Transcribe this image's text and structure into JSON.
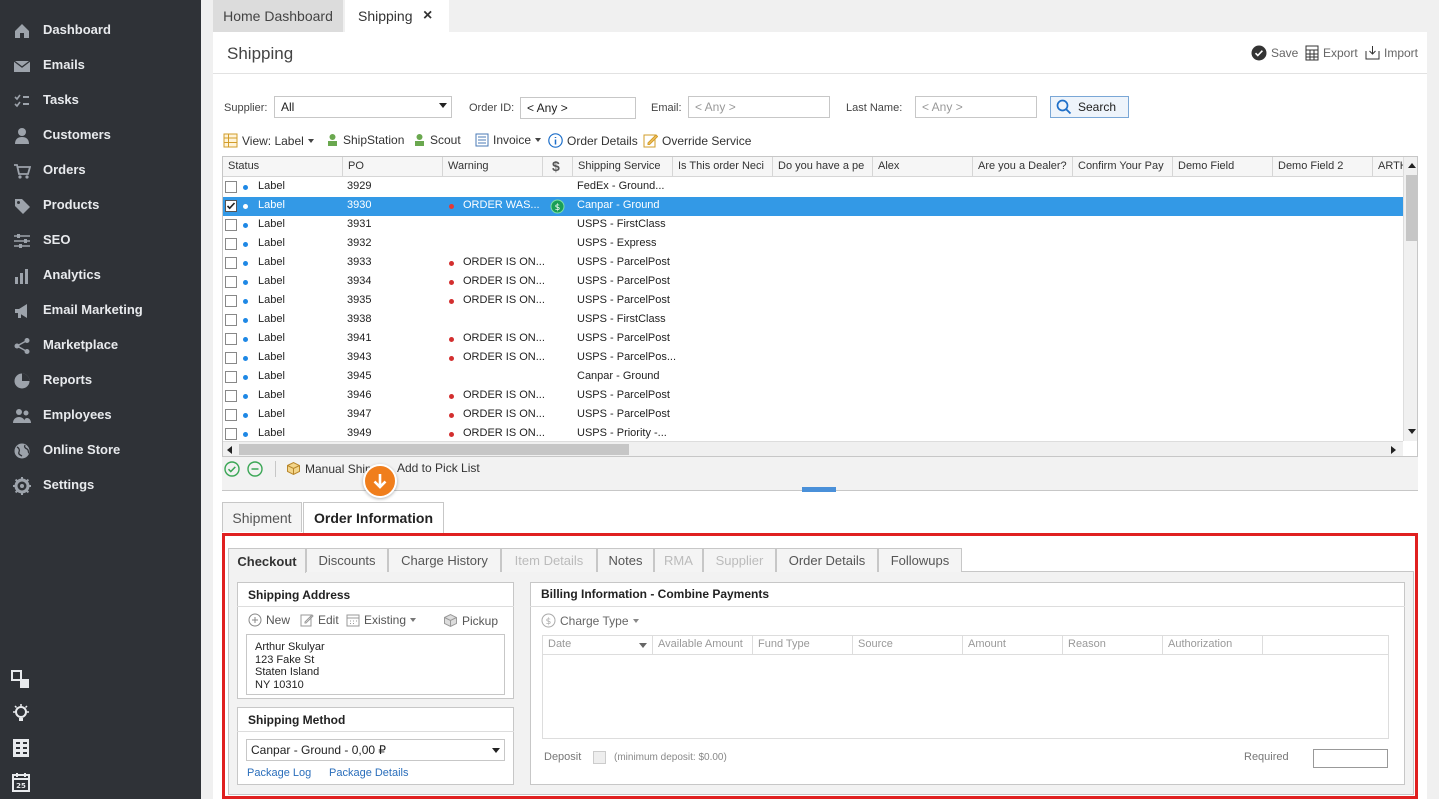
{
  "sidebar": {
    "items": [
      {
        "label": "Dashboard",
        "icon": "home-icon"
      },
      {
        "label": "Emails",
        "icon": "envelope-icon"
      },
      {
        "label": "Tasks",
        "icon": "tasks-icon"
      },
      {
        "label": "Customers",
        "icon": "user-icon"
      },
      {
        "label": "Orders",
        "icon": "cart-icon"
      },
      {
        "label": "Products",
        "icon": "tag-icon"
      },
      {
        "label": "SEO",
        "icon": "sliders-icon"
      },
      {
        "label": "Analytics",
        "icon": "bar-chart-icon"
      },
      {
        "label": "Email Marketing",
        "icon": "megaphone-icon"
      },
      {
        "label": "Marketplace",
        "icon": "share-icon"
      },
      {
        "label": "Reports",
        "icon": "pie-chart-icon"
      },
      {
        "label": "Employees",
        "icon": "users-icon"
      },
      {
        "label": "Online Store",
        "icon": "globe-icon"
      },
      {
        "label": "Settings",
        "icon": "gear-icon"
      }
    ]
  },
  "tabs": {
    "home": "Home Dashboard",
    "shipping": "Shipping",
    "close": "×"
  },
  "page": {
    "title": "Shipping",
    "save": "Save",
    "export": "Export",
    "import": "Import"
  },
  "filters": {
    "supplier_label": "Supplier:",
    "supplier_value": "All",
    "order_id_label": "Order ID:",
    "order_id_value": "< Any >",
    "email_label": "Email:",
    "email_placeholder": "< Any >",
    "lastname_label": "Last Name:",
    "lastname_placeholder": "< Any >",
    "search": "Search"
  },
  "toolbar": {
    "view": "View: Label",
    "shipstation": "ShipStation",
    "scout": "Scout",
    "invoice": "Invoice",
    "order_details": "Order Details",
    "override": "Override Service"
  },
  "grid": {
    "headers": [
      "Status",
      "PO",
      "Warning",
      "$",
      "Shipping Service",
      "Is This order Neci",
      "Do you have a pe",
      "Alex",
      "Are you a Dealer?",
      "Confirm Your Pay",
      "Demo Field",
      "Demo Field 2",
      "ARTH"
    ],
    "rows": [
      {
        "status": "Label",
        "po": "3929",
        "warning": "",
        "service": "FedEx - Ground...",
        "checked": false,
        "selected": false
      },
      {
        "status": "Label",
        "po": "3930",
        "warning": "ORDER WAS...",
        "service": "Canpar - Ground",
        "checked": true,
        "selected": true
      },
      {
        "status": "Label",
        "po": "3931",
        "warning": "",
        "service": "USPS - FirstClass",
        "checked": false,
        "selected": false
      },
      {
        "status": "Label",
        "po": "3932",
        "warning": "",
        "service": "USPS - Express",
        "checked": false,
        "selected": false
      },
      {
        "status": "Label",
        "po": "3933",
        "warning": "ORDER IS ON...",
        "service": "USPS - ParcelPost",
        "checked": false,
        "selected": false
      },
      {
        "status": "Label",
        "po": "3934",
        "warning": "ORDER IS ON...",
        "service": "USPS - ParcelPost",
        "checked": false,
        "selected": false
      },
      {
        "status": "Label",
        "po": "3935",
        "warning": "ORDER IS ON...",
        "service": "USPS - ParcelPost",
        "checked": false,
        "selected": false
      },
      {
        "status": "Label",
        "po": "3938",
        "warning": "",
        "service": "USPS - FirstClass",
        "checked": false,
        "selected": false
      },
      {
        "status": "Label",
        "po": "3941",
        "warning": "ORDER IS ON...",
        "service": "USPS - ParcelPost",
        "checked": false,
        "selected": false
      },
      {
        "status": "Label",
        "po": "3943",
        "warning": "ORDER IS ON...",
        "service": "USPS - ParcelPos...",
        "checked": false,
        "selected": false
      },
      {
        "status": "Label",
        "po": "3945",
        "warning": "",
        "service": "Canpar - Ground",
        "checked": false,
        "selected": false
      },
      {
        "status": "Label",
        "po": "3946",
        "warning": "ORDER IS ON...",
        "service": "USPS - ParcelPost",
        "checked": false,
        "selected": false
      },
      {
        "status": "Label",
        "po": "3947",
        "warning": "ORDER IS ON...",
        "service": "USPS - ParcelPost",
        "checked": false,
        "selected": false
      },
      {
        "status": "Label",
        "po": "3949",
        "warning": "ORDER IS ON...",
        "service": "USPS - Priority -...",
        "checked": false,
        "selected": false
      }
    ]
  },
  "bottombar": {
    "manual_ship": "Manual Ship",
    "add_pick": "Add to Pick List"
  },
  "lower_tabs": {
    "shipment": "Shipment",
    "order_info": "Order Information"
  },
  "sub_tabs": [
    "Checkout",
    "Discounts",
    "Charge History",
    "Item Details",
    "Notes",
    "RMA",
    "Supplier",
    "Order Details",
    "Followups"
  ],
  "shipping_address": {
    "title": "Shipping Address",
    "new": "New",
    "edit": "Edit",
    "existing": "Existing",
    "pickup": "Pickup",
    "lines": [
      "Arthur Skulyar",
      "123 Fake St",
      "Staten Island",
      "NY 10310"
    ]
  },
  "shipping_method": {
    "title": "Shipping Method",
    "value": "Canpar - Ground - 0,00 ₽",
    "package_log": "Package Log",
    "package_details": "Package Details"
  },
  "billing": {
    "title": "Billing Information - Combine Payments",
    "charge_type": "Charge Type",
    "headers": [
      "Date",
      "Available Amount",
      "Fund Type",
      "Source",
      "Amount",
      "Reason",
      "Authorization"
    ],
    "deposit": "Deposit",
    "min_deposit": "(minimum deposit: $0.00)",
    "required": "Required"
  }
}
